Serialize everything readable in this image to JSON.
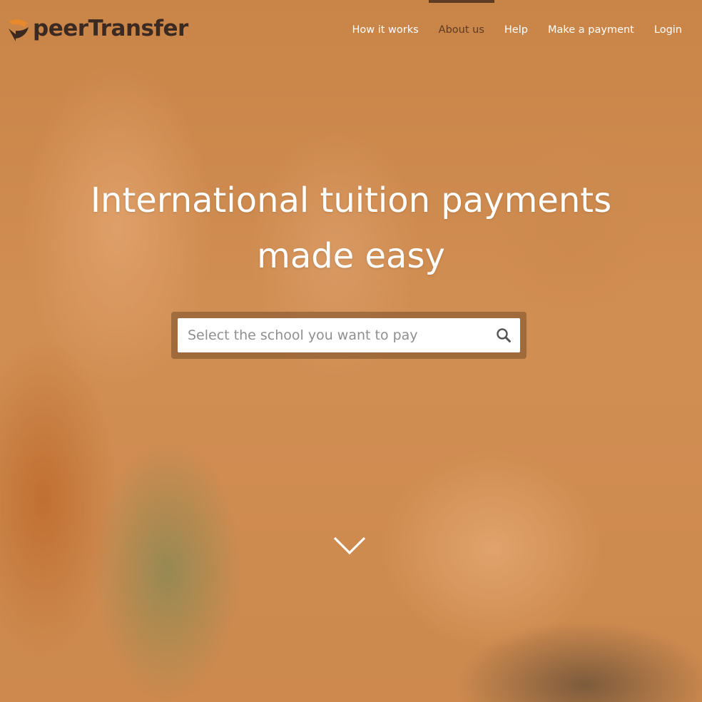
{
  "brand": {
    "name": "peerTransfer",
    "logo_icon": "peertransfer-arrows-logo-icon"
  },
  "nav": {
    "items": [
      {
        "label": "How it works",
        "active": false
      },
      {
        "label": "About us",
        "active": true
      },
      {
        "label": "Help",
        "active": false
      },
      {
        "label": "Make a payment",
        "active": false
      },
      {
        "label": "Login",
        "active": false
      }
    ]
  },
  "hero": {
    "headline_line1": "International tuition payments",
    "headline_line2": "made easy",
    "search": {
      "placeholder": "Select the school you want to pay",
      "value": "",
      "icon": "search-icon"
    },
    "scroll_icon": "chevron-down-icon"
  },
  "colors": {
    "overlay": "#d68a3c",
    "logo_dark": "#3a2a22",
    "logo_orange": "#e8892b",
    "active_nav": "#5b3b22",
    "text_light": "#ffffff"
  }
}
